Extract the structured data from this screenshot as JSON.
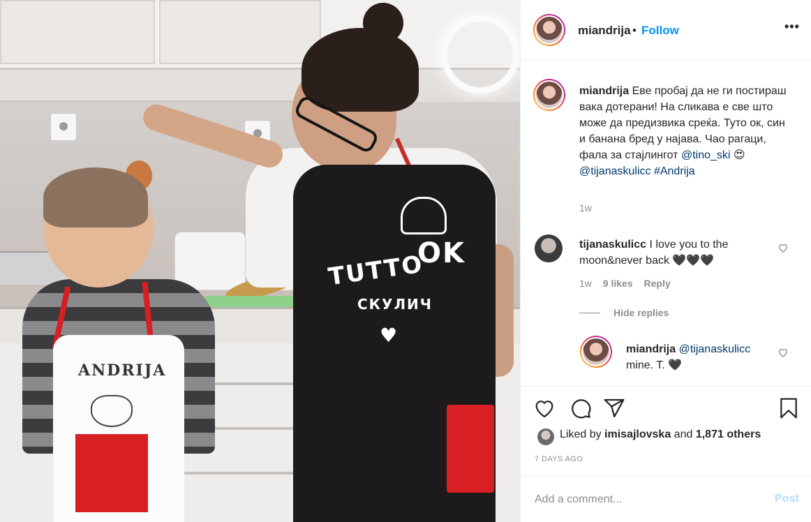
{
  "post": {
    "username": "miandrija",
    "dot": "•",
    "follow_label": "Follow",
    "more_label": "•••"
  },
  "caption": {
    "username": "miandrija",
    "text": "Еве пробај да не ги постираш вака дотерани! На сликава е све што може да предизвика среќа. Туто ок, син и банана бред у најава. Чао рагаци, фала за стајлингот",
    "mention1": "@tino_ski",
    "emoji": "😍",
    "mention2": "@tijanaskulicc",
    "hashtag": "#Andrija",
    "age": "1w"
  },
  "comments": [
    {
      "username": "tijanaskulicc",
      "text": "I love you to the moon&never back",
      "hearts": "🖤🖤🖤",
      "age": "1w",
      "likes": "9 likes",
      "reply_label": "Reply",
      "hide_replies": "Hide replies",
      "replies": [
        {
          "username": "miandrija",
          "mention": "@tijanaskulicc",
          "text": "mine. T.",
          "heart": "🖤"
        }
      ]
    }
  ],
  "likes": {
    "prefix": "Liked by",
    "user": "imisajlovska",
    "and": "and",
    "others": "1,871 others"
  },
  "timestamp": "7 DAYS AGO",
  "add_comment": {
    "placeholder": "Add a comment...",
    "post_label": "Post"
  },
  "photo": {
    "kid_apron_text": "ANDRIJA",
    "apron_word1": "TUTTO",
    "apron_word2": "OK",
    "apron_word3": "СКУЛИЧ"
  }
}
